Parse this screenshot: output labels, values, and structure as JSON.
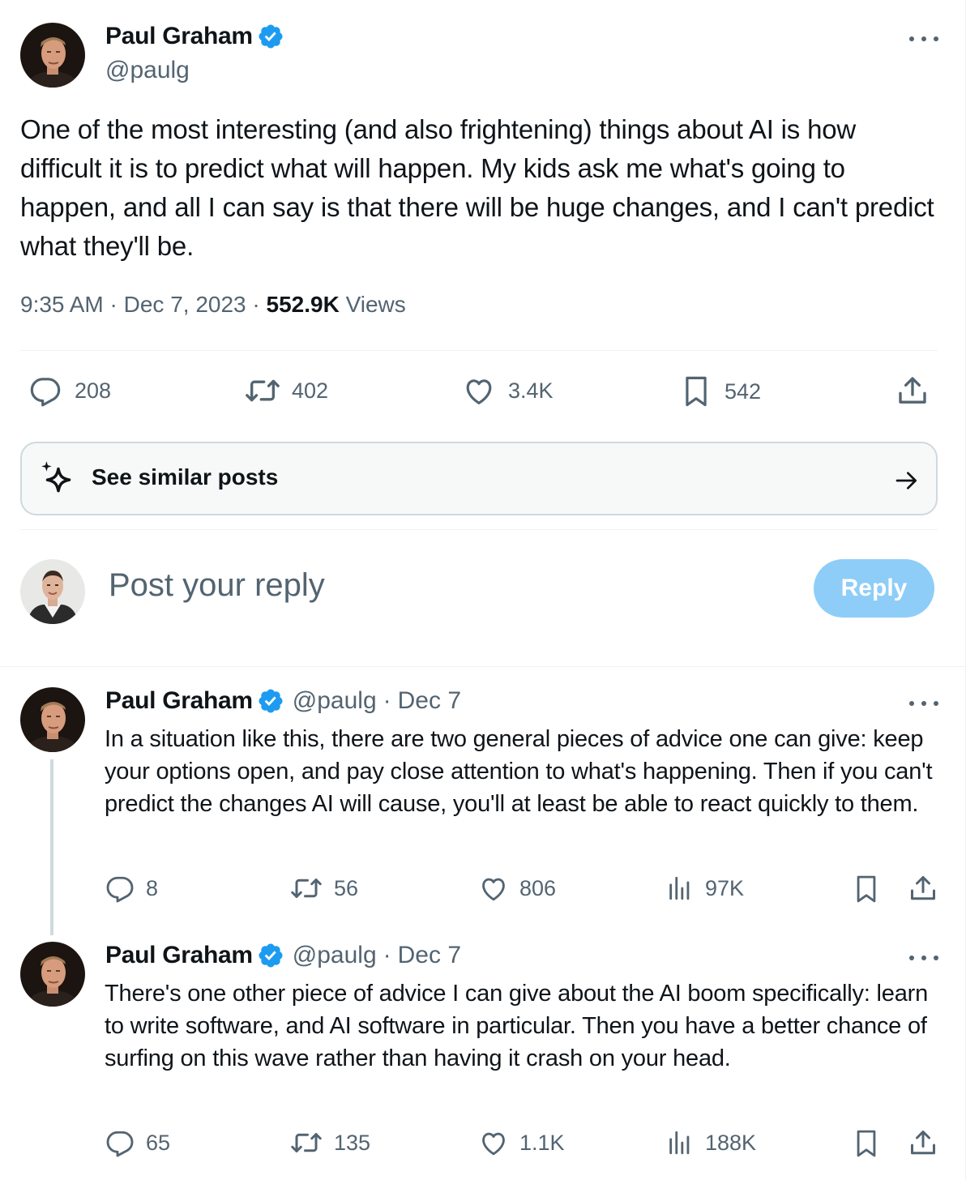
{
  "main_tweet": {
    "author_name": "Paul Graham",
    "handle": "@paulg",
    "text": "One of the most interesting (and also frightening) things about AI is how difficult it is to predict what will happen. My kids ask me what's going to happen, and all I can say is that there will be huge changes, and I can't predict what they'll be.",
    "time": "9:35 AM",
    "date": "Dec 7, 2023",
    "views_count": "552.9K",
    "views_label": "Views",
    "replies": "208",
    "reposts": "402",
    "likes": "3.4K",
    "bookmarks": "542"
  },
  "similar_posts": {
    "label": "See similar posts"
  },
  "reply_box": {
    "placeholder": "Post your reply",
    "button": "Reply"
  },
  "replies": [
    {
      "author_name": "Paul Graham",
      "handle": "@paulg",
      "date": "Dec 7",
      "text": "In a situation like this, there are two general pieces of advice one can give: keep your options open, and pay close attention to what's happening. Then if you can't predict the changes AI will cause, you'll at least be able to react quickly to them.",
      "replies": "8",
      "reposts": "56",
      "likes": "806",
      "views": "97K"
    },
    {
      "author_name": "Paul Graham",
      "handle": "@paulg",
      "date": "Dec 7",
      "text": "There's one other piece of advice I can give about the AI boom specifically: learn to write software, and AI software in particular. Then you have a better chance of surfing on this wave rather than having it crash on your head.",
      "replies": "65",
      "reposts": "135",
      "likes": "1.1K",
      "views": "188K"
    }
  ],
  "separators": {
    "dot": "·"
  },
  "colors": {
    "accent": "#1d9bf0",
    "muted": "#536471",
    "reply_button": "#8ecdf8"
  },
  "icons": [
    "verified-badge-icon",
    "more-icon",
    "reply-icon",
    "repost-icon",
    "like-icon",
    "bookmark-icon",
    "share-icon",
    "views-icon",
    "sparkle-icon",
    "arrow-right-icon"
  ]
}
